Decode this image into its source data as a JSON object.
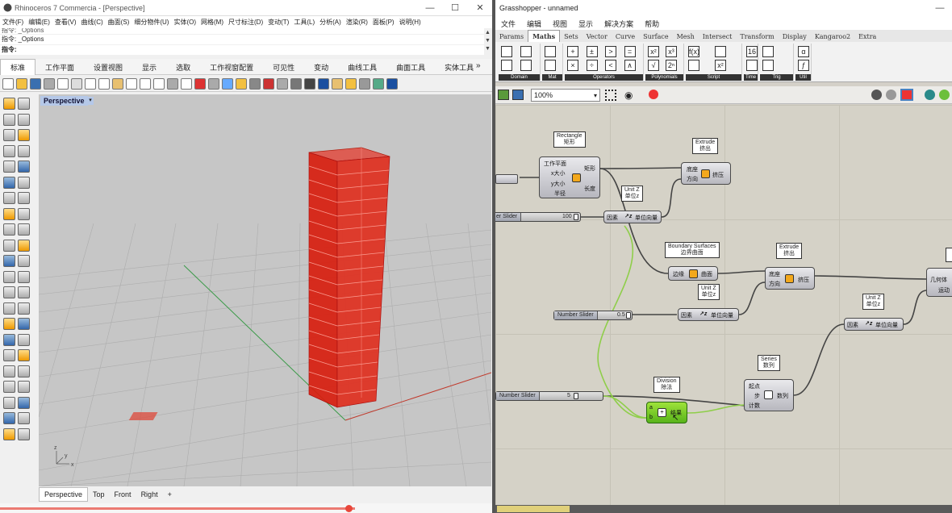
{
  "rhino": {
    "title": "Rhinoceros 7 Commercia - [Perspective]",
    "menu": [
      "文件(F)",
      "编辑(E)",
      "查看(V)",
      "曲线(C)",
      "曲面(S)",
      "细分物件(U)",
      "实体(O)",
      "网格(M)",
      "尺寸标注(D)",
      "变动(T)",
      "工具(L)",
      "分析(A)",
      "渲染(R)",
      "面板(P)",
      "说明(H)"
    ],
    "cmd_history": "指令: _Options",
    "cmd_history2": "指令: _Options",
    "cmd_prompt": "指令:",
    "tabs": [
      "标准",
      "工作平面",
      "设置视图",
      "显示",
      "选取",
      "工作视窗配置",
      "可见性",
      "变动",
      "曲线工具",
      "曲面工具",
      "实体工具"
    ],
    "active_tab": "标准",
    "viewport_label": "Perspective",
    "viewport_tabs": [
      "Perspective",
      "Top",
      "Front",
      "Right"
    ],
    "add_viewport": "+",
    "axis_x": "x",
    "axis_y": "y",
    "axis_z": "z",
    "colors": {
      "tower": "#d81e0f",
      "grid_bg": "#c8c8c8",
      "axis_x": "#c0392b",
      "axis_y": "#2e8b57"
    }
  },
  "gh": {
    "title": "Grasshopper - unnamed",
    "menu": [
      "文件",
      "编辑",
      "视图",
      "显示",
      "解决方案",
      "帮助"
    ],
    "tabs": [
      "Params",
      "Maths",
      "Sets",
      "Vector",
      "Curve",
      "Surface",
      "Mesh",
      "Intersect",
      "Transform",
      "Display",
      "Kangaroo2",
      "Extra"
    ],
    "active_tab": "Maths",
    "ribbon_groups": [
      {
        "label": "Domain",
        "icons": [
          "domain-icon",
          "domain2-icon",
          "domain3-icon",
          "domain4-icon"
        ]
      },
      {
        "label": "Mat",
        "icons": [
          "matrix-icon",
          "matrix2-icon"
        ]
      },
      {
        "label": "Operators",
        "icons": [
          "+",
          "×",
          "±",
          "÷",
          ">",
          "<",
          "=",
          "∧"
        ]
      },
      {
        "label": "Polynomials",
        "icons": [
          "x²",
          "√",
          "x³",
          "2ⁿ"
        ]
      },
      {
        "label": "Script",
        "icons": [
          "f(x)",
          "python-icon",
          "vb-icon",
          "x²"
        ]
      },
      {
        "label": "Time",
        "icons": [
          "16",
          "clock-icon"
        ]
      },
      {
        "label": "Trig",
        "icons": [
          "trig-icon",
          "trig2-icon"
        ]
      },
      {
        "label": "Util",
        "icons": [
          "α",
          "ƒ"
        ]
      }
    ],
    "zoom": "100%",
    "components": {
      "rectangle": {
        "tag1": "Rectangle",
        "tag2": "矩形",
        "in": [
          "工作平面",
          "x大小",
          "y大小",
          "半径"
        ],
        "out": [
          "矩形",
          "长度"
        ]
      },
      "extrude1": {
        "tag1": "Extrude",
        "tag2": "挤出",
        "in": [
          "底座",
          "方向"
        ],
        "name": "挤压"
      },
      "unitz1": {
        "tag1": "Unit Z",
        "tag2": "单位z",
        "in": "因素",
        "out": "单位向量"
      },
      "slider1": {
        "name": "er Slider",
        "value": "100"
      },
      "boundary": {
        "tag1": "Boundary Surfaces",
        "tag2": "边界曲面",
        "in": "边缘",
        "out": "曲面"
      },
      "extrude2": {
        "tag1": "Extrude",
        "tag2": "挤出",
        "in": [
          "底座",
          "方向"
        ],
        "name": "挤压"
      },
      "unitz2": {
        "tag1": "Unit Z",
        "tag2": "单位z",
        "in": "因素",
        "out": "单位向量"
      },
      "slider2": {
        "name": "Number Slider",
        "value": "0.5"
      },
      "unitz3": {
        "tag1": "Unit Z",
        "tag2": "单位z",
        "in": "因素",
        "out": "单位向量"
      },
      "series": {
        "tag1": "Series",
        "tag2": "数列",
        "in": [
          "起点",
          "步",
          "计数"
        ],
        "out": "数列"
      },
      "division": {
        "tag1": "Division",
        "tag2": "除法",
        "in": [
          "a",
          "b"
        ],
        "out": "结果"
      },
      "slider3": {
        "name": "Number Slider",
        "value": "5"
      },
      "right": {
        "in": "几何体",
        "out": "运动"
      }
    }
  }
}
